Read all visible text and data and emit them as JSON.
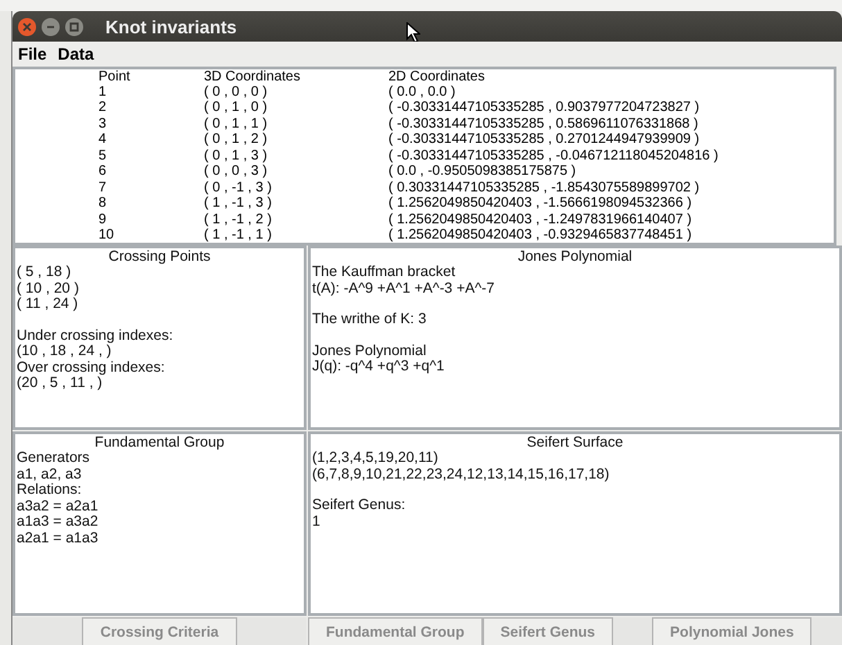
{
  "window": {
    "title": "Knot invariants"
  },
  "menu": [
    "File",
    "Data"
  ],
  "points_table": {
    "columns": [
      "Point",
      "3D Coordinates",
      "2D Coordinates"
    ],
    "rows": [
      [
        "1",
        "( 0 , 0 , 0 )",
        "( 0.0 , 0.0 )"
      ],
      [
        "2",
        "( 0 , 1 , 0 )",
        "( -0.30331447105335285 , 0.9037977204723827 )"
      ],
      [
        "3",
        "( 0 , 1 , 1 )",
        "( -0.30331447105335285 , 0.5869611076331868 )"
      ],
      [
        "4",
        "( 0 , 1 , 2 )",
        "( -0.30331447105335285 , 0.2701244947939909 )"
      ],
      [
        "5",
        "( 0 , 1 , 3 )",
        "( -0.30331447105335285 , -0.046712118045204816 )"
      ],
      [
        "6",
        "( 0 , 0 , 3 )",
        "( 0.0 , -0.9505098385175875 )"
      ],
      [
        "7",
        "( 0 , -1 , 3 )",
        "( 0.30331447105335285 , -1.8543075589899702 )"
      ],
      [
        "8",
        "( 1 , -1 , 3 )",
        "( 1.2562049850420403 , -1.5666198094532366 )"
      ],
      [
        "9",
        "( 1 , -1 , 2 )",
        "( 1.2562049850420403 , -1.2497831966140407 )"
      ],
      [
        "10",
        "( 1 , -1 , 1 )",
        "( 1.2562049850420403 , -0.9329465837748451 )"
      ]
    ]
  },
  "panels": [
    {
      "title": "Crossing Points",
      "groups": [
        [
          "( 5 , 18 )",
          "( 10 , 20 )",
          "( 11 , 24 )"
        ],
        [
          "Under crossing indexes:",
          "(10 , 18 , 24 , )",
          "Over crossing indexes:",
          "(20 , 5 , 11 , )"
        ]
      ]
    },
    {
      "title": "Jones Polynomial",
      "groups": [
        [
          "The Kauffman bracket",
          "t(A): -A^9 +A^1 +A^-3 +A^-7"
        ],
        [
          "The writhe of K: 3"
        ],
        [
          "Jones Polynomial",
          "J(q):  -q^4 +q^3 +q^1"
        ]
      ]
    },
    {
      "title": "Fundamental Group",
      "groups": [
        [
          "Generators",
          "a1, a2, a3",
          "Relations:",
          "a3a2 = a2a1",
          "a1a3 = a3a2",
          "a2a1 = a1a3"
        ]
      ]
    },
    {
      "title": "Seifert Surface",
      "groups": [
        [
          "(1,2,3,4,5,19,20,11)",
          "(6,7,8,9,10,21,22,23,24,12,13,14,15,16,17,18)"
        ],
        [
          "Seifert Genus:",
          "1"
        ]
      ]
    }
  ],
  "left_buttons": [
    "Crossing Criteria"
  ],
  "right_buttons": [
    "Fundamental Group",
    "Seifert Genus",
    "Polynomial Jones"
  ]
}
